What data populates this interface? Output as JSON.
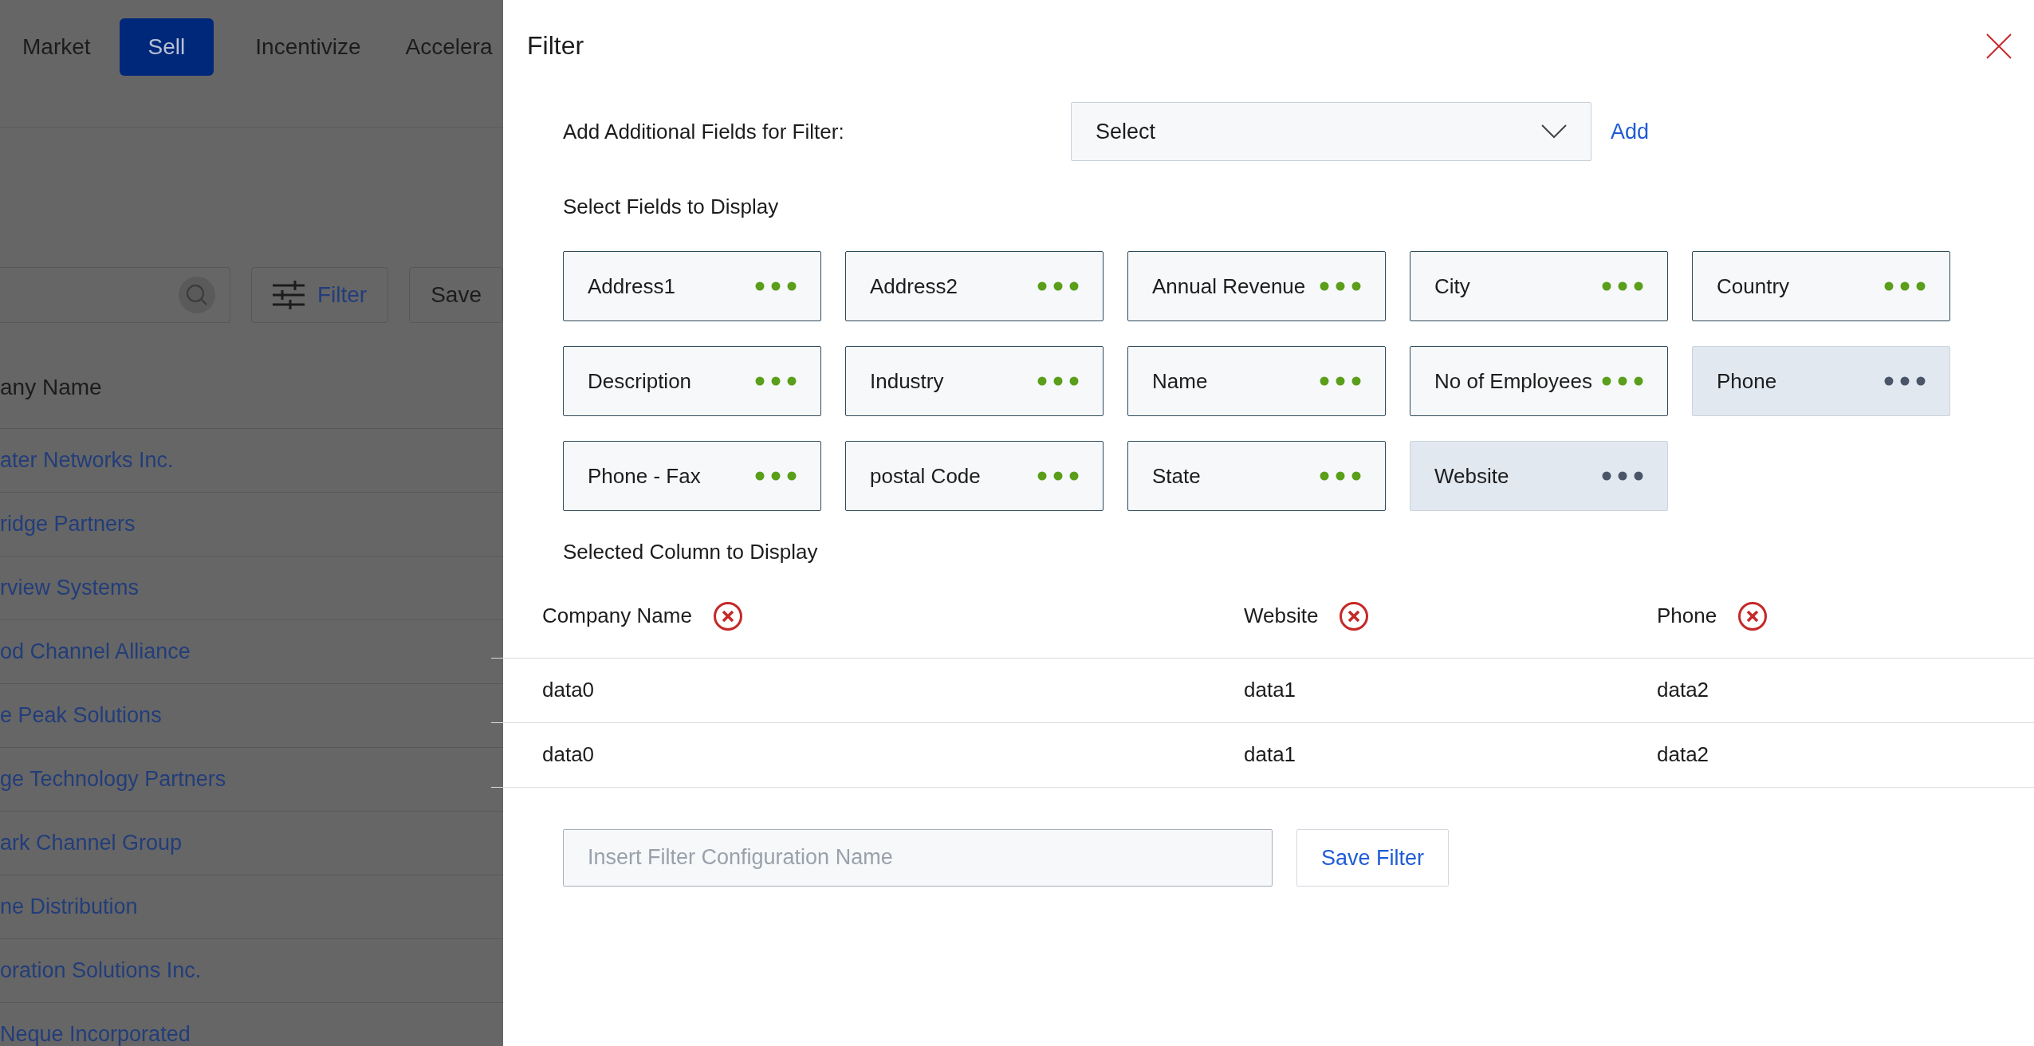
{
  "background_page": {
    "nav_tabs": [
      {
        "label": "Market",
        "selected": false
      },
      {
        "label": "Sell",
        "selected": true
      },
      {
        "label": "Incentivize",
        "selected": false
      },
      {
        "label": "Accelera",
        "selected": false
      }
    ],
    "filter_button": "Filter",
    "save_button": "Save",
    "table_header": "any Name",
    "rows": [
      "ater Networks Inc.",
      "ridge Partners",
      "rview Systems",
      "od Channel Alliance",
      "e Peak Solutions",
      "ge Technology Partners",
      "ark Channel Group",
      "ne Distribution",
      "oration Solutions Inc.",
      "Neque Incorporated"
    ]
  },
  "filter_panel": {
    "title": "Filter",
    "add_fields_label": "Add Additional Fields for Filter:",
    "select": {
      "value": "Select"
    },
    "add_link": "Add",
    "fields_heading": "Select Fields to Display",
    "fields": [
      {
        "label": "Address1",
        "selected": false
      },
      {
        "label": "Address2",
        "selected": false
      },
      {
        "label": "Annual Revenue",
        "selected": false
      },
      {
        "label": "City",
        "selected": false
      },
      {
        "label": "Country",
        "selected": false
      },
      {
        "label": "Description",
        "selected": false
      },
      {
        "label": "Industry",
        "selected": false
      },
      {
        "label": "Name",
        "selected": false
      },
      {
        "label": "No of Employees",
        "selected": false
      },
      {
        "label": "Phone",
        "selected": true
      },
      {
        "label": "Phone - Fax",
        "selected": false
      },
      {
        "label": "postal Code",
        "selected": false
      },
      {
        "label": "State",
        "selected": false
      },
      {
        "label": "Website",
        "selected": true
      }
    ],
    "columns_heading": "Selected Column to Display",
    "columns": [
      "Company Name",
      "Website",
      "Phone"
    ],
    "rows": [
      [
        "data0",
        "data1",
        "data2"
      ],
      [
        "data0",
        "data1",
        "data2"
      ]
    ],
    "name_field": {
      "placeholder": "Insert Filter Configuration Name"
    },
    "save_button": "Save Filter"
  }
}
